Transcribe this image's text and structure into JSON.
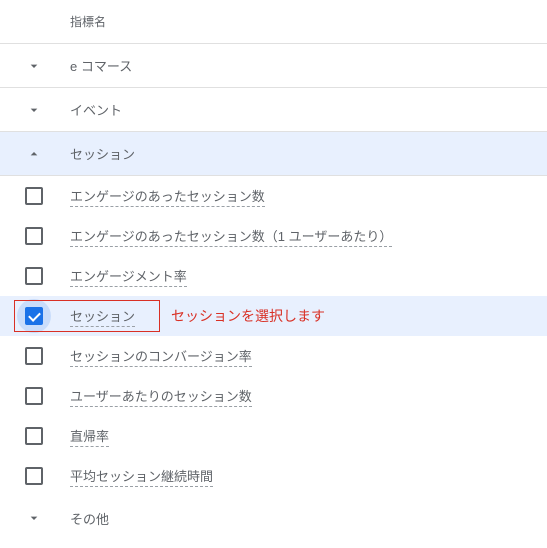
{
  "header": {
    "column_label": "指標名"
  },
  "categories": [
    {
      "label": "e コマース",
      "expanded": false
    },
    {
      "label": "イベント",
      "expanded": false
    },
    {
      "label": "セッション",
      "expanded": true,
      "metrics": [
        {
          "label": "エンゲージのあったセッション数",
          "checked": false
        },
        {
          "label": "エンゲージのあったセッション数（1 ユーザーあたり）",
          "checked": false
        },
        {
          "label": "エンゲージメント率",
          "checked": false
        },
        {
          "label": "セッション",
          "checked": true
        },
        {
          "label": "セッションのコンバージョン率",
          "checked": false
        },
        {
          "label": "ユーザーあたりのセッション数",
          "checked": false
        },
        {
          "label": "直帰率",
          "checked": false
        },
        {
          "label": "平均セッション継続時間",
          "checked": false
        }
      ]
    },
    {
      "label": "その他",
      "expanded": false
    }
  ],
  "annotation": {
    "text": "セッションを選択します"
  }
}
